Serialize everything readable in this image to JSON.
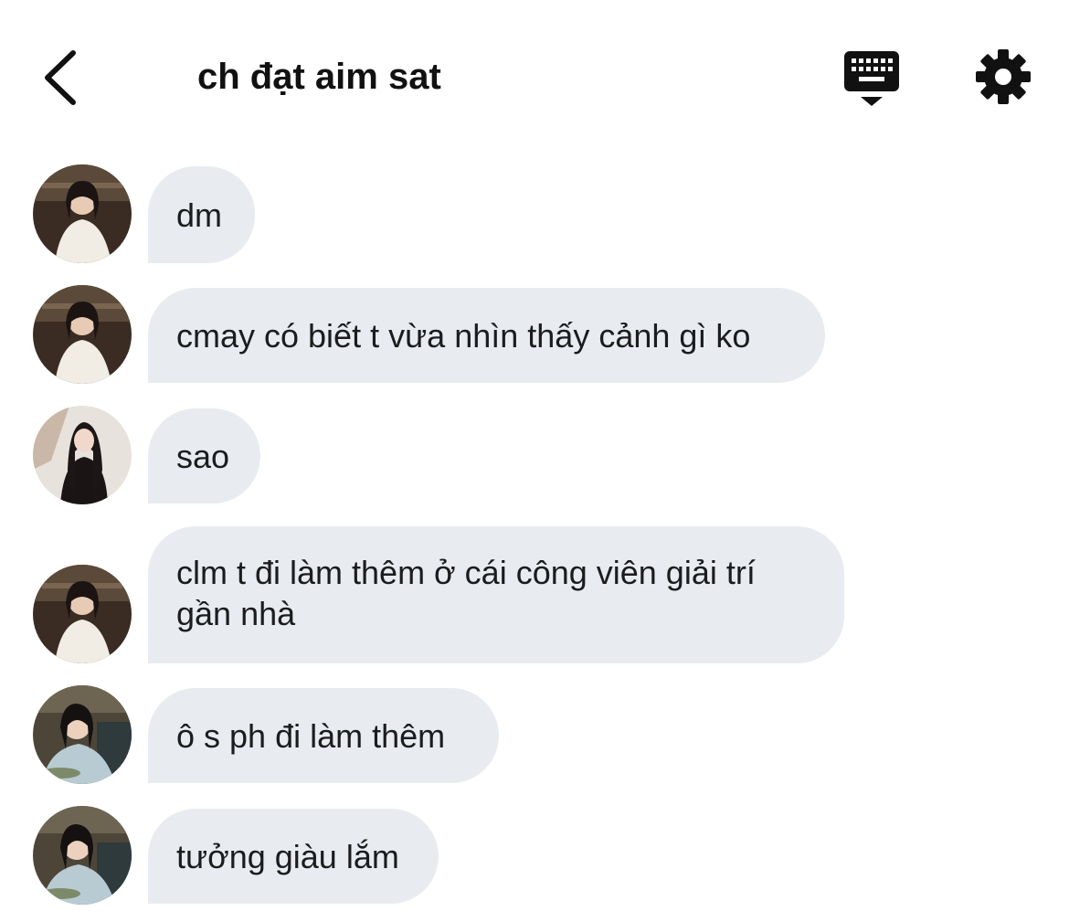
{
  "header": {
    "title": "ch đạt aim sat",
    "back_icon": "chevron-left-icon",
    "keyboard_icon": "keyboard-icon",
    "settings_icon": "gear-icon"
  },
  "colors": {
    "bubble": "#e8ecf0",
    "text": "#1c1c1e",
    "title": "#111111"
  },
  "messages": [
    {
      "text": "dm"
    },
    {
      "text": "cmay có biết t vừa nhìn thấy cảnh gì ko"
    },
    {
      "text": "sao"
    },
    {
      "text": "clm t đi làm thêm ở cái công viên giải trí gần nhà"
    },
    {
      "text": "ô s ph đi làm thêm"
    },
    {
      "text": "tưởng giàu lắm"
    }
  ]
}
